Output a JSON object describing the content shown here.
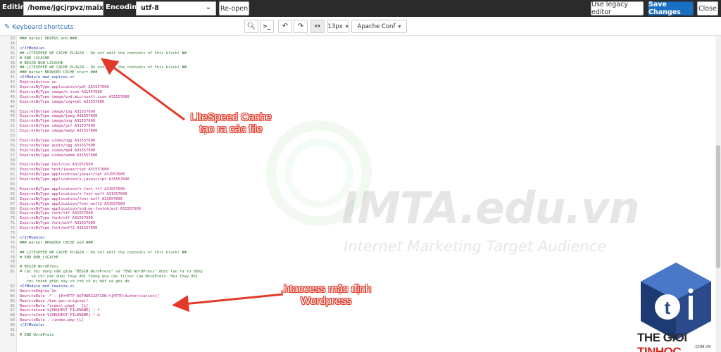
{
  "topbar": {
    "editing_label": "Editing:",
    "path": "/home/jgcjrpvz/maixepto",
    "encoding_label": "Encoding:",
    "encoding_value": "utf-8",
    "reopen_label": "Re-open",
    "legacy_label": "Use legacy editor",
    "save_label": "Save Changes",
    "close_label": "Close"
  },
  "toolbar": {
    "keyboard_shortcuts": "Keyboard shortcuts",
    "font_size": "13px",
    "mode": "Apache Conf"
  },
  "icons": {
    "search": "search-icon",
    "terminal": "terminal-icon",
    "undo": "undo-icon",
    "redo": "redo-icon",
    "wrap": "wrap-icon",
    "keyboard": "keyboard-icon"
  },
  "colors": {
    "save_button": "#1b6fc2",
    "annotation": "#e23a2a",
    "topbar": "#2b2b2b"
  },
  "editor": {
    "lines": [
      {
        "n": "33",
        "t": "### marker DROPQS end ###",
        "c": "comment"
      },
      {
        "n": "34",
        "t": "",
        "c": "plain"
      },
      {
        "n": "35",
        "t": "</IfModule>",
        "c": "tag"
      },
      {
        "n": "36",
        "t": "## LITESPEED WP CACHE PLUGIN - Do not edit the contents of this block! ##",
        "c": "comment"
      },
      {
        "n": "37",
        "t": "# END LSCACHE",
        "c": "comment"
      },
      {
        "n": "38",
        "t": "# BEGIN NON_LSCACHE",
        "c": "comment"
      },
      {
        "n": "39",
        "t": "## LITESPEED WP CACHE PLUGIN - Do not edit the contents of this block! ##",
        "c": "comment"
      },
      {
        "n": "40",
        "t": "### marker BROWSER CACHE start ###",
        "c": "comment"
      },
      {
        "n": "41",
        "t": "<IfModule mod_expires.c>",
        "c": "tag"
      },
      {
        "n": "42",
        "t": "ExpiresActive on",
        "c": "dir"
      },
      {
        "n": "43",
        "t": "ExpiresByType application/pdf A31557600",
        "c": "dir"
      },
      {
        "n": "44",
        "t": "ExpiresByType image/x-icon A31557600",
        "c": "dir"
      },
      {
        "n": "45",
        "t": "ExpiresByType image/vnd.microsoft.icon A31557600",
        "c": "dir"
      },
      {
        "n": "46",
        "t": "ExpiresByType image/svg+xml A31557600",
        "c": "dir"
      },
      {
        "n": "47",
        "t": "",
        "c": "plain"
      },
      {
        "n": "48",
        "t": "ExpiresByType image/jpg A31557600",
        "c": "dir"
      },
      {
        "n": "49",
        "t": "ExpiresByType image/jpeg A31557600",
        "c": "dir"
      },
      {
        "n": "50",
        "t": "ExpiresByType image/png A31557600",
        "c": "dir"
      },
      {
        "n": "51",
        "t": "ExpiresByType image/gif A31557600",
        "c": "dir"
      },
      {
        "n": "52",
        "t": "ExpiresByType image/webp A31557600",
        "c": "dir"
      },
      {
        "n": "53",
        "t": "",
        "c": "plain"
      },
      {
        "n": "54",
        "t": "ExpiresByType video/ogg A31557600",
        "c": "dir"
      },
      {
        "n": "55",
        "t": "ExpiresByType audio/ogg A31557600",
        "c": "dir"
      },
      {
        "n": "56",
        "t": "ExpiresByType video/mp4 A31557600",
        "c": "dir"
      },
      {
        "n": "57",
        "t": "ExpiresByType video/webm A31557600",
        "c": "dir"
      },
      {
        "n": "58",
        "t": "",
        "c": "plain"
      },
      {
        "n": "59",
        "t": "ExpiresByType text/css A31557600",
        "c": "dir"
      },
      {
        "n": "60",
        "t": "ExpiresByType text/javascript A31557600",
        "c": "dir"
      },
      {
        "n": "61",
        "t": "ExpiresByType application/javascript A31557600",
        "c": "dir"
      },
      {
        "n": "62",
        "t": "ExpiresByType application/x-javascript A31557600",
        "c": "dir"
      },
      {
        "n": "63",
        "t": "",
        "c": "plain"
      },
      {
        "n": "64",
        "t": "ExpiresByType application/x-font-ttf A31557600",
        "c": "dir"
      },
      {
        "n": "65",
        "t": "ExpiresByType application/x-font-woff A31557600",
        "c": "dir"
      },
      {
        "n": "66",
        "t": "ExpiresByType application/font-woff A31557600",
        "c": "dir"
      },
      {
        "n": "67",
        "t": "ExpiresByType application/font-woff2 A31557600",
        "c": "dir"
      },
      {
        "n": "68",
        "t": "ExpiresByType application/vnd.ms-fontobject A31557600",
        "c": "dir"
      },
      {
        "n": "69",
        "t": "ExpiresByType font/ttf A31557600",
        "c": "dir"
      },
      {
        "n": "70",
        "t": "ExpiresByType font/otf A31557600",
        "c": "dir"
      },
      {
        "n": "71",
        "t": "ExpiresByType font/woff A31557600",
        "c": "dir"
      },
      {
        "n": "72",
        "t": "ExpiresByType font/woff2 A31557600",
        "c": "dir"
      },
      {
        "n": "73",
        "t": "",
        "c": "plain"
      },
      {
        "n": "74",
        "t": "</IfModule>",
        "c": "tag"
      },
      {
        "n": "75",
        "t": "### marker BROWSER CACHE end ###",
        "c": "comment"
      },
      {
        "n": "76",
        "t": "",
        "c": "plain"
      },
      {
        "n": "77",
        "t": "## LITESPEED WP CACHE PLUGIN - Do not edit the contents of this block! ##",
        "c": "comment"
      },
      {
        "n": "78",
        "t": "# END NON_LSCACHE",
        "c": "comment"
      },
      {
        "n": "79",
        "t": "",
        "c": "plain"
      },
      {
        "n": "80",
        "t": "# BEGIN WordPress",
        "c": "comment"
      },
      {
        "n": "81",
        "t": "# Các nội dung nằm giữa \"BEGIN WordPress\" và \"END WordPress\" được tạo ra tự động",
        "c": "comment"
      },
      {
        "n": "",
        "t": "   , và chỉ nên được thay đổi thông qua các filter của WordPress. Mọi thay đổi",
        "c": "comment"
      },
      {
        "n": "",
        "t": "   tới thành phần này có thể sẽ bị mất và ghi đè.",
        "c": "comment"
      },
      {
        "n": "82",
        "t": "<IfModule mod_rewrite.c>",
        "c": "tag"
      },
      {
        "n": "83",
        "t": "RewriteEngine On",
        "c": "dir"
      },
      {
        "n": "84",
        "t": "RewriteRule .* - [E=HTTP_AUTHORIZATION:%{HTTP:Authorization}]",
        "c": "dir"
      },
      {
        "n": "85",
        "t": "RewriteBase /ban-goc-original/",
        "c": "dir"
      },
      {
        "n": "86",
        "t": "RewriteRule ^index\\.php$ - [L]",
        "c": "dir"
      },
      {
        "n": "87",
        "t": "RewriteCond %{REQUEST_FILENAME} !-f",
        "c": "dir"
      },
      {
        "n": "88",
        "t": "RewriteCond %{REQUEST_FILENAME} !-d",
        "c": "dir"
      },
      {
        "n": "89",
        "t": "RewriteRule . /index.php [L]",
        "c": "dir"
      },
      {
        "n": "90",
        "t": "</IfModule>",
        "c": "tag"
      },
      {
        "n": "91",
        "t": "",
        "c": "plain"
      },
      {
        "n": "92",
        "t": "# END WordPress",
        "c": "comment"
      }
    ]
  },
  "watermark": {
    "title": "IMTA.edu.vn",
    "subtitle": "Internet Marketing Target Audience"
  },
  "annotations": {
    "litespeed": "LiteSpeed Cache\ntạo ra các file",
    "htaccess": ".htaccess mặc định\nWordpress"
  },
  "logo": {
    "part1": "THE GIOI ",
    "part2": "TINHOC",
    "domain": ".COM.VN"
  }
}
